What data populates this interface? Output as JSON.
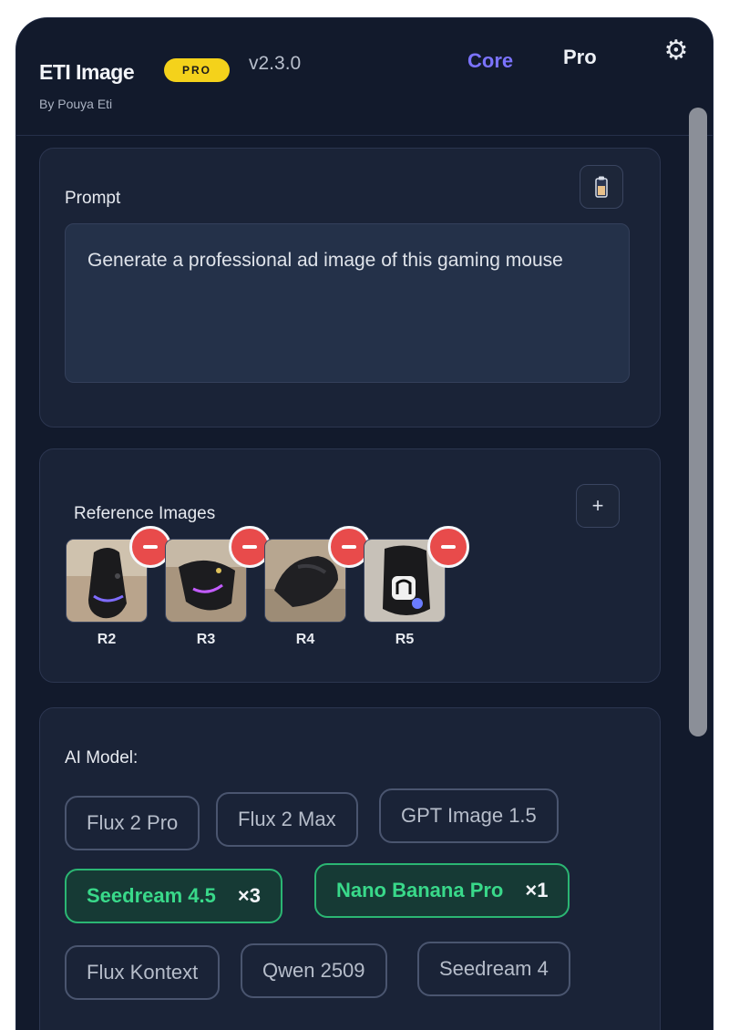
{
  "header": {
    "title": "ETI Image",
    "badge": "PRO",
    "version": "v2.3.0",
    "byline": "By Pouya Eti",
    "tabs": [
      "Core",
      "Pro"
    ],
    "active_tab": "Core",
    "settings_icon": "gear-icon"
  },
  "prompt": {
    "label": "Prompt",
    "value": "Generate a professional ad image of this gaming mouse",
    "action_icon": "clipboard-icon"
  },
  "references": {
    "label": "Reference Images",
    "add_icon": "plus-icon",
    "remove_icon": "minus-icon",
    "items": [
      {
        "name": "R2"
      },
      {
        "name": "R3"
      },
      {
        "name": "R4"
      },
      {
        "name": "R5"
      }
    ]
  },
  "model": {
    "label": "AI Model:",
    "options": [
      {
        "label": "Flux 2 Pro",
        "multiplier": null,
        "selected": false
      },
      {
        "label": "Flux 2 Max",
        "multiplier": null,
        "selected": false
      },
      {
        "label": "GPT Image 1.5",
        "multiplier": null,
        "selected": false
      },
      {
        "label": "Seedream 4.5",
        "multiplier": "×3",
        "selected": true
      },
      {
        "label": "Nano Banana Pro",
        "multiplier": "×1",
        "selected": true
      },
      {
        "label": "Flux Kontext",
        "multiplier": null,
        "selected": false
      },
      {
        "label": "Qwen 2509",
        "multiplier": null,
        "selected": false
      },
      {
        "label": "Seedream 4",
        "multiplier": null,
        "selected": false
      }
    ]
  },
  "colors": {
    "accent": "#7b73ff",
    "badge": "#f4d21b",
    "selected": "#39d98a",
    "remove": "#e84b4b",
    "background": "#121a2c"
  }
}
